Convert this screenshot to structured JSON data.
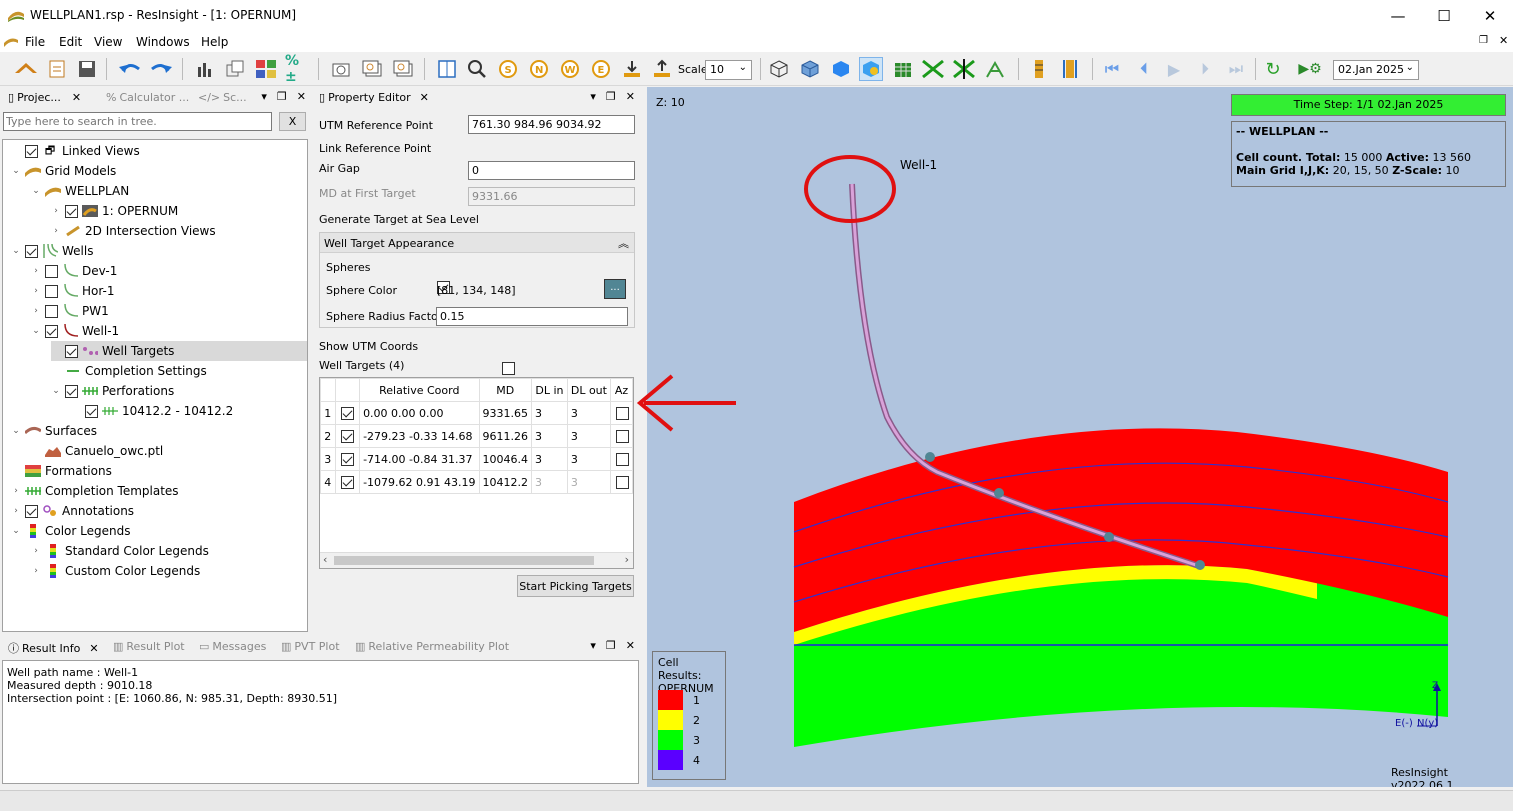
{
  "window": {
    "title": "WELLPLAN1.rsp - ResInsight - [1: OPERNUM]"
  },
  "menu": {
    "file": "File",
    "edit": "Edit",
    "view": "View",
    "windows": "Windows",
    "help": "Help"
  },
  "toolbar": {
    "scale_label": "Scale",
    "scale_value": "10",
    "date_value": "02.Jan 2025"
  },
  "project_tree": {
    "tabs": [
      "Projec...",
      "Calculator ...",
      "Sc..."
    ],
    "search_placeholder": "Type here to search in tree.",
    "clear_label": "X",
    "items": [
      {
        "label": "Linked Views"
      },
      {
        "label": "Grid Models"
      },
      {
        "label": "WELLPLAN"
      },
      {
        "label": "1: OPERNUM"
      },
      {
        "label": "2D Intersection Views"
      },
      {
        "label": "Wells"
      },
      {
        "label": "Dev-1"
      },
      {
        "label": "Hor-1"
      },
      {
        "label": "PW1"
      },
      {
        "label": "Well-1"
      },
      {
        "label": "Well Targets"
      },
      {
        "label": "Completion Settings"
      },
      {
        "label": "Perforations"
      },
      {
        "label": "10412.2 - 10412.2"
      },
      {
        "label": "Surfaces"
      },
      {
        "label": "Canuelo_owc.ptl"
      },
      {
        "label": "Formations"
      },
      {
        "label": "Completion Templates"
      },
      {
        "label": "Annotations"
      },
      {
        "label": "Color Legends"
      },
      {
        "label": "Standard Color Legends"
      },
      {
        "label": "Custom Color Legends"
      }
    ]
  },
  "property_editor": {
    "tab": "Property Editor",
    "utm_label": "UTM Reference Point",
    "utm_value": "761.30 984.96 9034.92",
    "link_label": "Link Reference Point",
    "airgap_label": "Air Gap",
    "airgap_value": "0",
    "md_label": "MD at First Target",
    "md_value": "9331.66",
    "gen_label": "Generate Target at Sea Level",
    "group_title": "Well Target Appearance",
    "spheres_label": "Spheres",
    "sphere_color_label": "Sphere Color",
    "sphere_color_value": "[81, 134, 148]",
    "sphere_color_btn": "...",
    "sphere_color_hex": "#518694",
    "radius_label": "Sphere Radius Factor",
    "radius_value": "0.15",
    "show_utm_label": "Show UTM Coords",
    "targets_label": "Well Targets (4)",
    "columns": [
      "Relative Coord",
      "MD",
      "DL in",
      "DL out",
      "Az"
    ],
    "rows": [
      {
        "n": "1",
        "coord": "0.00 0.00 0.00",
        "md": "9331.65",
        "dlin": "3",
        "dlout": "3"
      },
      {
        "n": "2",
        "coord": "-279.23 -0.33 14.68",
        "md": "9611.26",
        "dlin": "3",
        "dlout": "3"
      },
      {
        "n": "3",
        "coord": "-714.00 -0.84 31.37",
        "md": "10046.4",
        "dlin": "3",
        "dlout": "3"
      },
      {
        "n": "4",
        "coord": "-1079.62 0.91 43.19",
        "md": "10412.2",
        "dlin": "3",
        "dlout": "3"
      }
    ],
    "start_btn": "Start Picking Targets"
  },
  "result_info": {
    "tabs": [
      "Result Info",
      "Result Plot",
      "Messages",
      "PVT Plot",
      "Relative Permeability Plot"
    ],
    "lines": [
      "Well path name : Well-1",
      "Measured depth : 9010.18",
      "Intersection point : [E: 1060.86, N: 985.31, Depth: 8930.51]"
    ]
  },
  "viewer": {
    "zlabel": "Z: 10",
    "timestep": "Time Step: 1/1 02.Jan 2025",
    "info_title": "-- WELLPLAN --",
    "cell_count_label": "Cell count. Total:",
    "cell_total": "15 000",
    "active_label": "Active:",
    "cell_active": "13 560",
    "main_grid_label": "Main Grid I,J,K:",
    "main_grid": "20, 15, 50",
    "zscale_label": "Z-Scale:",
    "zscale": "10",
    "well_label": "Well-1",
    "legend_title_1": "Cell Results:",
    "legend_title_2": "OPERNUM",
    "legend": [
      {
        "label": "1",
        "color": "#ff0000"
      },
      {
        "label": "2",
        "color": "#ffff00"
      },
      {
        "label": "3",
        "color": "#00ff00"
      },
      {
        "label": "4",
        "color": "#5a00ff"
      }
    ],
    "axis_z": "Z",
    "axis_e": "E(-)",
    "axis_n": "N(y)",
    "version": "ResInsight v2022.06.1",
    "background": "#b0c4de"
  }
}
